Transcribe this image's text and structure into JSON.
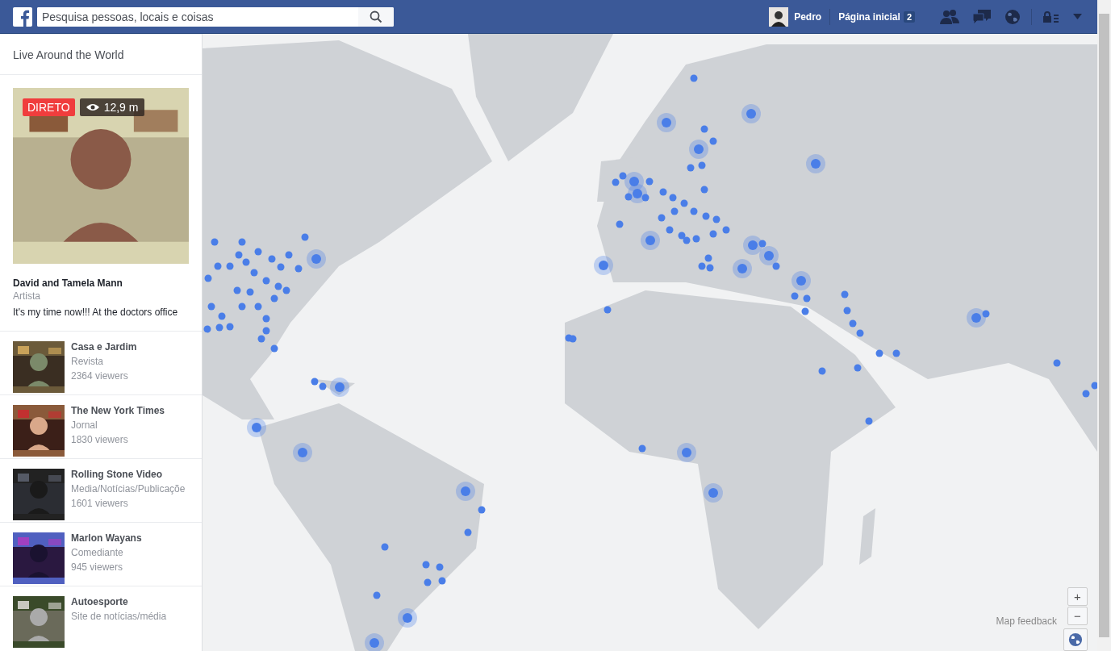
{
  "header": {
    "search": {
      "placeholder": "Pesquisa pessoas, locais e coisas"
    },
    "profile": {
      "name": "Pedro"
    },
    "home": {
      "label": "Página inicial",
      "count": "2"
    }
  },
  "sidebar": {
    "title": "Live Around the World",
    "featured": {
      "badge": "DIRETO",
      "views": "12,9 m",
      "name": "David and Tamela Mann",
      "category": "Artista",
      "description": "It's my time now!!! At the doctors office"
    },
    "items": [
      {
        "name": "Casa e Jardim",
        "category": "Revista",
        "viewers": "2364 viewers"
      },
      {
        "name": "The New York Times",
        "category": "Jornal",
        "viewers": "1830 viewers"
      },
      {
        "name": "Rolling Stone Video",
        "category": "Media/Notícias/Publicaçõe",
        "viewers": "1601 viewers"
      },
      {
        "name": "Marlon Wayans",
        "category": "Comediante",
        "viewers": "945 viewers"
      },
      {
        "name": "Autoesporte",
        "category": "Site de notícias/média"
      }
    ]
  },
  "map": {
    "feedback": "Map feedback",
    "zoom_in": "+",
    "zoom_out": "−"
  }
}
